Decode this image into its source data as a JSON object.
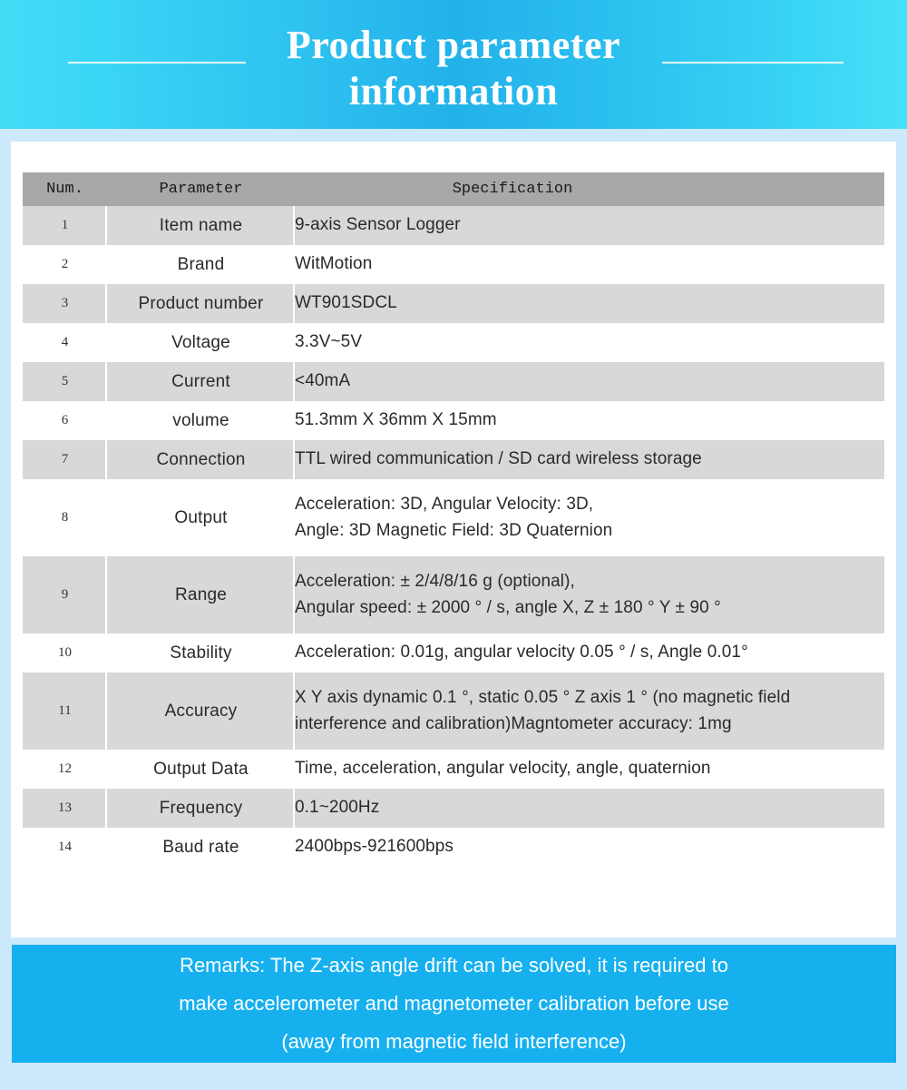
{
  "header": {
    "title_line1": "Product parameter",
    "title_line2": "information"
  },
  "table": {
    "columns": [
      "Num.",
      "Parameter",
      "Specification"
    ],
    "rows": [
      {
        "num": "1",
        "parameter": "Item name",
        "spec": [
          "9-axis Sensor Logger"
        ]
      },
      {
        "num": "2",
        "parameter": "Brand",
        "spec": [
          "WitMotion"
        ]
      },
      {
        "num": "3",
        "parameter": "Product number",
        "spec": [
          "WT901SDCL"
        ]
      },
      {
        "num": "4",
        "parameter": "Voltage",
        "spec": [
          "3.3V~5V"
        ]
      },
      {
        "num": "5",
        "parameter": "Current",
        "spec": [
          "<40mA"
        ]
      },
      {
        "num": "6",
        "parameter": "volume",
        "spec": [
          "51.3mm X 36mm X 15mm"
        ]
      },
      {
        "num": "7",
        "parameter": "Connection",
        "spec": [
          "TTL wired communication / SD card wireless storage"
        ]
      },
      {
        "num": "8",
        "parameter": "Output",
        "spec": [
          "Acceleration: 3D, Angular Velocity: 3D,",
          "Angle: 3D Magnetic Field: 3D Quaternion"
        ]
      },
      {
        "num": "9",
        "parameter": "Range",
        "spec": [
          "Acceleration: ± 2/4/8/16 g (optional),",
          "Angular speed: ± 2000 ° / s, angle X, Z ± 180 ° Y ± 90 °"
        ]
      },
      {
        "num": "10",
        "parameter": "Stability",
        "spec": [
          "Acceleration: 0.01g, angular velocity 0.05 ° / s, Angle  0.01°"
        ]
      },
      {
        "num": "11",
        "parameter": "Accuracy",
        "spec": [
          "X Y axis dynamic 0.1 °, static 0.05 ° Z axis 1 ° (no magnetic field",
          "interference and calibration)Magntometer accuracy: 1mg"
        ]
      },
      {
        "num": "12",
        "parameter": "Output Data",
        "spec": [
          "Time, acceleration, angular velocity, angle, quaternion"
        ]
      },
      {
        "num": "13",
        "parameter": "Frequency",
        "spec": [
          "0.1~200Hz"
        ]
      },
      {
        "num": "14",
        "parameter": "Baud rate",
        "spec": [
          "2400bps-921600bps"
        ]
      }
    ]
  },
  "remarks": {
    "line1": "Remarks: The Z-axis angle drift can be solved, it is required to",
    "line2": "make accelerometer and magnetometer calibration before use",
    "line3": "(away from magnetic field interference)"
  },
  "colors": {
    "banner_accent": "#29b6ec",
    "remarks_background": "#16b0ef",
    "page_background": "#cce9fb",
    "table_header": "#a8a8a8",
    "row_shade": "#d8d8d8"
  }
}
